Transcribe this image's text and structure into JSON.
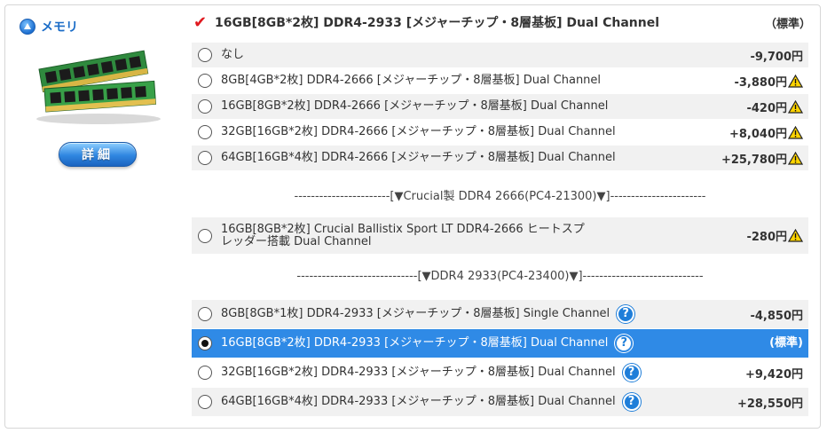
{
  "category": {
    "title": "メモリ",
    "icon": "up-arrow-circle-icon"
  },
  "detail_button": "詳細",
  "header": {
    "selected_label": "16GB[8GB*2枚] DDR4-2933 [メジャーチップ・8層基板] Dual Channel",
    "badge": "（標準）"
  },
  "options": [
    {
      "label": "なし",
      "price": "-9,700円",
      "warn": false,
      "help": false,
      "selected": false
    },
    {
      "label": "8GB[4GB*2枚] DDR4-2666 [メジャーチップ・8層基板] Dual Channel",
      "price": "-3,880円",
      "warn": true,
      "help": false,
      "selected": false
    },
    {
      "label": "16GB[8GB*2枚] DDR4-2666 [メジャーチップ・8層基板] Dual Channel",
      "price": "-420円",
      "warn": true,
      "help": false,
      "selected": false
    },
    {
      "label": "32GB[16GB*2枚] DDR4-2666 [メジャーチップ・8層基板] Dual Channel",
      "price": "+8,040円",
      "warn": true,
      "help": false,
      "selected": false
    },
    {
      "label": "64GB[16GB*4枚] DDR4-2666 [メジャーチップ・8層基板] Dual Channel",
      "price": "+25,780円",
      "warn": true,
      "help": false,
      "selected": false
    },
    {
      "label": "16GB[8GB*2枚] Crucial Ballistix Sport LT DDR4-2666 ヒートスプレッダー搭載 Dual Channel",
      "price": "-280円",
      "warn": true,
      "help": false,
      "selected": false
    },
    {
      "label": "8GB[8GB*1枚] DDR4-2933 [メジャーチップ・8層基板] Single Channel",
      "price": "-4,850円",
      "warn": false,
      "help": true,
      "selected": false
    },
    {
      "label": "16GB[8GB*2枚] DDR4-2933 [メジャーチップ・8層基板] Dual Channel",
      "price": "(標準)",
      "warn": false,
      "help": true,
      "selected": true
    },
    {
      "label": "32GB[16GB*2枚] DDR4-2933 [メジャーチップ・8層基板] Dual Channel",
      "price": "+9,420円",
      "warn": false,
      "help": true,
      "selected": false
    },
    {
      "label": "64GB[16GB*4枚] DDR4-2933 [メジャーチップ・8層基板] Dual Channel",
      "price": "+28,550円",
      "warn": false,
      "help": true,
      "selected": false
    }
  ],
  "separators": [
    "-----------------------[▼Crucial製 DDR4 2666(PC4-21300)▼]-----------------------",
    "-----------------------------[▼DDR4 2933(PC4-23400)▼]-----------------------------"
  ],
  "help_glyph": "?",
  "colors": {
    "accent": "#2f8ae6",
    "check": "#e0191f",
    "title": "#1a6cc7"
  }
}
